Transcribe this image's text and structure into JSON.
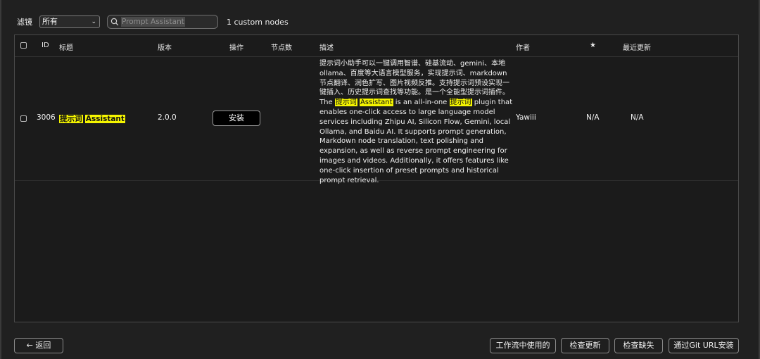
{
  "filter": {
    "label": "滤镜",
    "selected": "所有",
    "search_value": "Prompt Assistant",
    "count_text": "1 custom nodes"
  },
  "table": {
    "headers": {
      "id": "ID",
      "title": "标题",
      "version": "版本",
      "action": "操作",
      "node_count": "节点数",
      "description": "描述",
      "author": "作者",
      "star": "★",
      "updated": "最近更新"
    },
    "rows": [
      {
        "id": "3006",
        "title_part1": "提示词",
        "title_part2": "Assistant",
        "version": "2.0.0",
        "action_label": "安装",
        "node_count": "",
        "desc_zh": "提示词小助手可以一键调用智谱、硅基流动、gemini、本地ollama、百度等大语言模型服务，实现提示词、markdown节点翻译、润色扩写、图片视频反推。支持提示词预设实现一键插入、历史提示词查找等功能。是一个全能型提示词插件。The ",
        "desc_hl1": "提示词",
        "desc_mid1": " ",
        "desc_hl2": "Assistant",
        "desc_mid2": " is an all-in-one ",
        "desc_hl3": "提示词",
        "desc_en": " plugin that enables one-click access to large language model services including Zhipu AI, Silicon Flow, Gemini, local Ollama, and Baidu AI. It supports prompt generation, Markdown node translation, text polishing and expansion, as well as reverse prompt engineering for images and videos. Additionally, it offers features like one-click insertion of preset prompts and historical prompt retrieval.",
        "author": "Yawiii",
        "stars": "N/A",
        "updated": "N/A"
      }
    ]
  },
  "footer": {
    "back_label": "返回",
    "in_workflow_label": "工作流中使用的",
    "check_update_label": "检查更新",
    "check_missing_label": "检查缺失",
    "git_url_label": "通过Git URL安装"
  }
}
